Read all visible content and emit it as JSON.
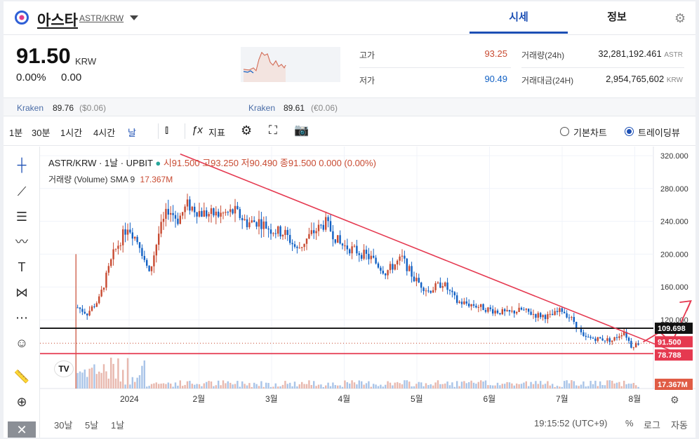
{
  "header": {
    "coin_name": "아스타",
    "pair": "ASTR/KRW",
    "tabs": [
      {
        "label": "시세",
        "active": true
      },
      {
        "label": "정보",
        "active": false
      }
    ]
  },
  "summary": {
    "price": "91.50",
    "unit": "KRW",
    "change_pct": "0.00%",
    "change_abs": "0.00",
    "high_label": "고가",
    "high_value": "93.25",
    "low_label": "저가",
    "low_value": "90.49",
    "volume_label": "거래량(24h)",
    "volume_value": "32,281,192.461",
    "volume_unit": "ASTR",
    "amount_label": "거래대금(24H)",
    "amount_value": "2,954,765,602",
    "amount_unit": "KRW"
  },
  "exchanges": [
    {
      "name": "Kraken",
      "price": "89.76",
      "fx": "($0.06)"
    },
    {
      "name": "Kraken",
      "price": "89.61",
      "fx": "(€0.06)"
    }
  ],
  "toolbar": {
    "intervals": [
      {
        "label": "1분",
        "selected": false
      },
      {
        "label": "30분",
        "selected": false
      },
      {
        "label": "1시간",
        "selected": false
      },
      {
        "label": "4시간",
        "selected": false
      },
      {
        "label": "날",
        "selected": true
      }
    ],
    "indicator_label": "지표",
    "chart_modes": [
      {
        "label": "기본차트",
        "selected": false
      },
      {
        "label": "트레이딩뷰",
        "selected": true
      }
    ]
  },
  "legend": {
    "symbol": "ASTR/KRW · 1날 · UPBIT",
    "o_label": "시",
    "o_value": "91.500",
    "h_label": "고",
    "h_value": "93.250",
    "l_label": "저",
    "l_value": "90.490",
    "c_label": "종",
    "c_value": "91.500",
    "chg": "0.000 (0.00%)",
    "volume_label": "거래량 (Volume)",
    "sma_label": "SMA 9",
    "sma_value": "17.367M"
  },
  "bottom": {
    "ranges": [
      "30날",
      "5날",
      "1날"
    ],
    "clock": "19:15:52 (UTC+9)",
    "pct": "%",
    "log": "로그",
    "auto": "자동"
  },
  "chart_data": {
    "type": "candlestick",
    "x_ticks": [
      "2024",
      "2월",
      "3월",
      "4월",
      "5월",
      "6월",
      "7월",
      "8월"
    ],
    "y_ticks": [
      "320.000",
      "280.000",
      "240.000",
      "200.000",
      "160.000",
      "120.000"
    ],
    "ylim": [
      40,
      330
    ],
    "price_labels": [
      {
        "value": "109.698",
        "kind": "hline"
      },
      {
        "value": "91.500",
        "kind": "last"
      },
      {
        "value": "78.788",
        "kind": "hline-red"
      },
      {
        "value": "17.367M",
        "kind": "volume"
      }
    ],
    "close_path": [
      [
        "2023-12-10",
        60
      ],
      [
        "2023-12-11",
        135
      ],
      [
        "2023-12-15",
        128
      ],
      [
        "2023-12-20",
        145
      ],
      [
        "2023-12-26",
        200
      ],
      [
        "2024-01-01",
        235
      ],
      [
        "2024-01-06",
        212
      ],
      [
        "2024-01-10",
        175
      ],
      [
        "2024-01-14",
        225
      ],
      [
        "2024-01-18",
        255
      ],
      [
        "2024-01-22",
        242
      ],
      [
        "2024-01-26",
        260
      ],
      [
        "2024-02-01",
        250
      ],
      [
        "2024-02-08",
        248
      ],
      [
        "2024-02-15",
        252
      ],
      [
        "2024-02-20",
        238
      ],
      [
        "2024-02-25",
        240
      ],
      [
        "2024-03-01",
        230
      ],
      [
        "2024-03-07",
        225
      ],
      [
        "2024-03-12",
        205
      ],
      [
        "2024-03-18",
        225
      ],
      [
        "2024-03-24",
        238
      ],
      [
        "2024-03-30",
        212
      ],
      [
        "2024-04-05",
        205
      ],
      [
        "2024-04-12",
        195
      ],
      [
        "2024-04-18",
        178
      ],
      [
        "2024-04-25",
        195
      ],
      [
        "2024-04-30",
        170
      ],
      [
        "2024-05-06",
        155
      ],
      [
        "2024-05-12",
        165
      ],
      [
        "2024-05-18",
        142
      ],
      [
        "2024-05-25",
        138
      ],
      [
        "2024-06-01",
        132
      ],
      [
        "2024-06-08",
        128
      ],
      [
        "2024-06-14",
        132
      ],
      [
        "2024-06-20",
        126
      ],
      [
        "2024-06-26",
        124
      ],
      [
        "2024-07-01",
        132
      ],
      [
        "2024-07-06",
        118
      ],
      [
        "2024-07-10",
        98
      ],
      [
        "2024-07-16",
        97
      ],
      [
        "2024-07-22",
        95
      ],
      [
        "2024-07-27",
        106
      ],
      [
        "2024-07-30",
        88
      ],
      [
        "2024-08-02",
        91.5
      ]
    ],
    "trendline": [
      [
        "2024-01-23",
        322
      ],
      [
        "2024-08-23",
        74
      ]
    ],
    "projection": [
      [
        "2024-08-04",
        93
      ],
      [
        "2024-08-11",
        105
      ],
      [
        "2024-08-16",
        92
      ],
      [
        "2024-08-24",
        143
      ]
    ]
  }
}
